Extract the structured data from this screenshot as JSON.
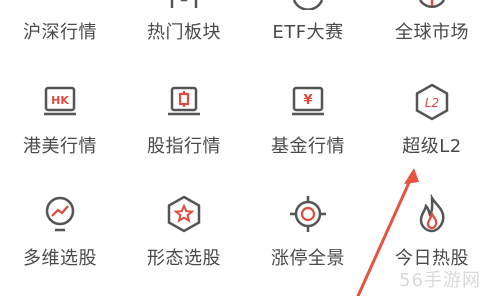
{
  "accent_color": "#e04b3f",
  "icon_stroke_color": "#555555",
  "row1": [
    {
      "label": "沪深行情"
    },
    {
      "label": "热门板块"
    },
    {
      "label": "ETF大赛"
    },
    {
      "label": "全球市场"
    }
  ],
  "row2": [
    {
      "label": "港美行情",
      "icon": "hk-market-icon",
      "icon_text": "HK"
    },
    {
      "label": "股指行情",
      "icon": "index-futures-icon"
    },
    {
      "label": "基金行情",
      "icon": "fund-icon",
      "icon_text": "¥"
    },
    {
      "label": "超级L2",
      "icon": "l2-hexagon-icon",
      "icon_text": "L2"
    }
  ],
  "row3": [
    {
      "label": "多维选股",
      "icon": "trend-bulb-icon"
    },
    {
      "label": "形态选股",
      "icon": "star-hexagon-icon"
    },
    {
      "label": "涨停全景",
      "icon": "target-icon"
    },
    {
      "label": "今日热股",
      "icon": "flame-icon"
    }
  ],
  "watermark": "56手游网"
}
